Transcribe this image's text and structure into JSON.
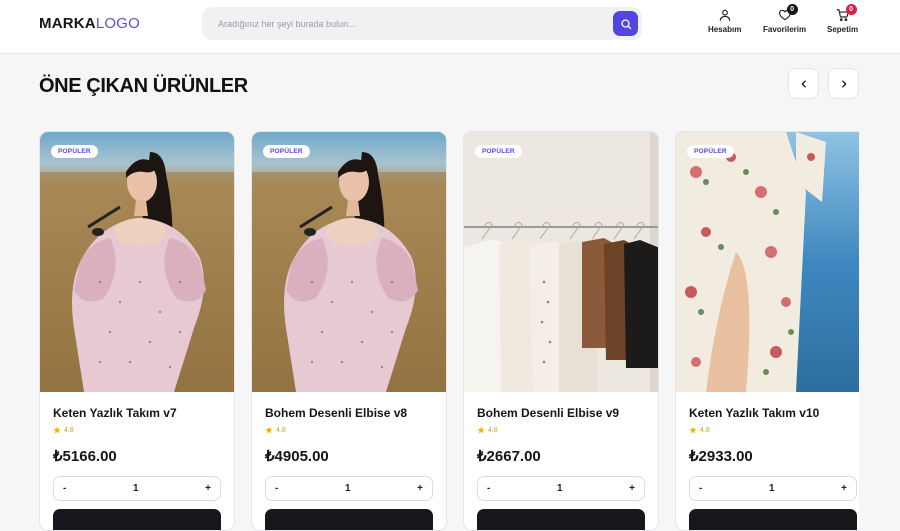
{
  "header": {
    "logo_bold": "MARKA",
    "logo_accent": "LOGO",
    "search_placeholder": "Aradığınız her şeyi burada bulun...",
    "account_label": "Hesabım",
    "favorites_label": "Favorilerim",
    "favorites_count": "0",
    "cart_label": "Sepetim",
    "cart_count": "0"
  },
  "section": {
    "title": "ÖNE ÇIKAN ÜRÜNLER"
  },
  "products": [
    {
      "badge": "POPÜLER",
      "name": "Keten Yazlık Takım v7",
      "rating": "4.8",
      "price": "₺5166.00",
      "qty": "1",
      "minus": "-",
      "plus": "+"
    },
    {
      "badge": "POPÜLER",
      "name": "Bohem Desenli Elbise v8",
      "rating": "4.8",
      "price": "₺4905.00",
      "qty": "1",
      "minus": "-",
      "plus": "+"
    },
    {
      "badge": "POPÜLER",
      "name": "Bohem Desenli Elbise v9",
      "rating": "4.8",
      "price": "₺2667.00",
      "qty": "1",
      "minus": "-",
      "plus": "+"
    },
    {
      "badge": "POPÜLER",
      "name": "Keten Yazlık Takım v10",
      "rating": "4.8",
      "price": "₺2933.00",
      "qty": "1",
      "minus": "-",
      "plus": "+"
    }
  ],
  "colors": {
    "accent": "#4f46e5",
    "badge_red": "#e11d48",
    "star": "#f5b301"
  },
  "icons": [
    "search-icon",
    "user-icon",
    "heart-icon",
    "cart-icon",
    "chevron-left-icon",
    "chevron-right-icon",
    "star-icon"
  ]
}
